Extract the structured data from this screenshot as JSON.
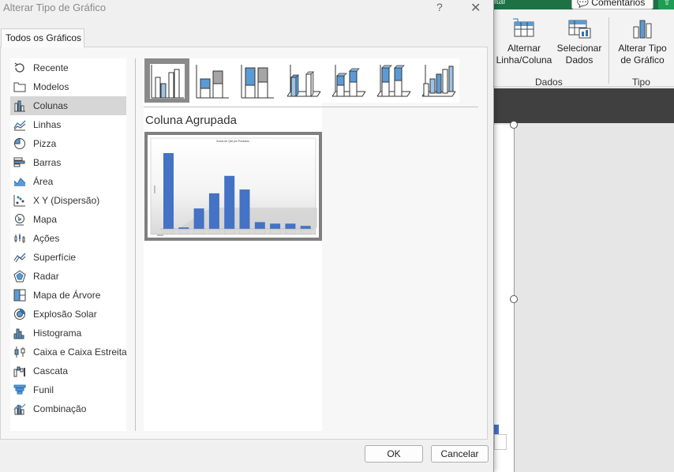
{
  "dialog": {
    "title": "Alterar Tipo de Gráfico",
    "help": "?",
    "close": "✕",
    "tab": "Todos os Gráficos",
    "categories": [
      {
        "label": "Recente",
        "icon": "recent-icon"
      },
      {
        "label": "Modelos",
        "icon": "folder-icon"
      },
      {
        "label": "Colunas",
        "icon": "column-chart-icon",
        "selected": true
      },
      {
        "label": "Linhas",
        "icon": "line-chart-icon"
      },
      {
        "label": "Pizza",
        "icon": "pie-chart-icon"
      },
      {
        "label": "Barras",
        "icon": "bar-chart-icon"
      },
      {
        "label": "Área",
        "icon": "area-chart-icon"
      },
      {
        "label": "X Y (Dispersão)",
        "icon": "scatter-chart-icon"
      },
      {
        "label": "Mapa",
        "icon": "map-chart-icon"
      },
      {
        "label": "Ações",
        "icon": "stock-chart-icon"
      },
      {
        "label": "Superfície",
        "icon": "surface-chart-icon"
      },
      {
        "label": "Radar",
        "icon": "radar-chart-icon"
      },
      {
        "label": "Mapa de Árvore",
        "icon": "treemap-chart-icon"
      },
      {
        "label": "Explosão Solar",
        "icon": "sunburst-chart-icon"
      },
      {
        "label": "Histograma",
        "icon": "histogram-chart-icon"
      },
      {
        "label": "Caixa e Caixa Estreita",
        "icon": "box-whisker-chart-icon"
      },
      {
        "label": "Cascata",
        "icon": "waterfall-chart-icon"
      },
      {
        "label": "Funil",
        "icon": "funnel-chart-icon"
      },
      {
        "label": "Combinação",
        "icon": "combo-chart-icon"
      }
    ],
    "selected_subtype_name": "Coluna Agrupada",
    "preview_chart": {
      "title": "Soma de Qtd por Produtos",
      "values": [
        100,
        2,
        27,
        47,
        70,
        52,
        9,
        7,
        7,
        4
      ]
    },
    "ok_label": "OK",
    "cancel_label": "Cancelar"
  },
  "ribbon": {
    "comments_label": "Comentários",
    "switch_label_1": "Alternar",
    "switch_label_2": "Linha/Coluna",
    "select_label_1": "Selecionar",
    "select_label_2": "Dados",
    "group_data": "Dados",
    "change_label_1": "Alterar Tipo",
    "change_label_2": "de Gráfico",
    "group_type": "Tipo",
    "cut_text": "itar"
  }
}
